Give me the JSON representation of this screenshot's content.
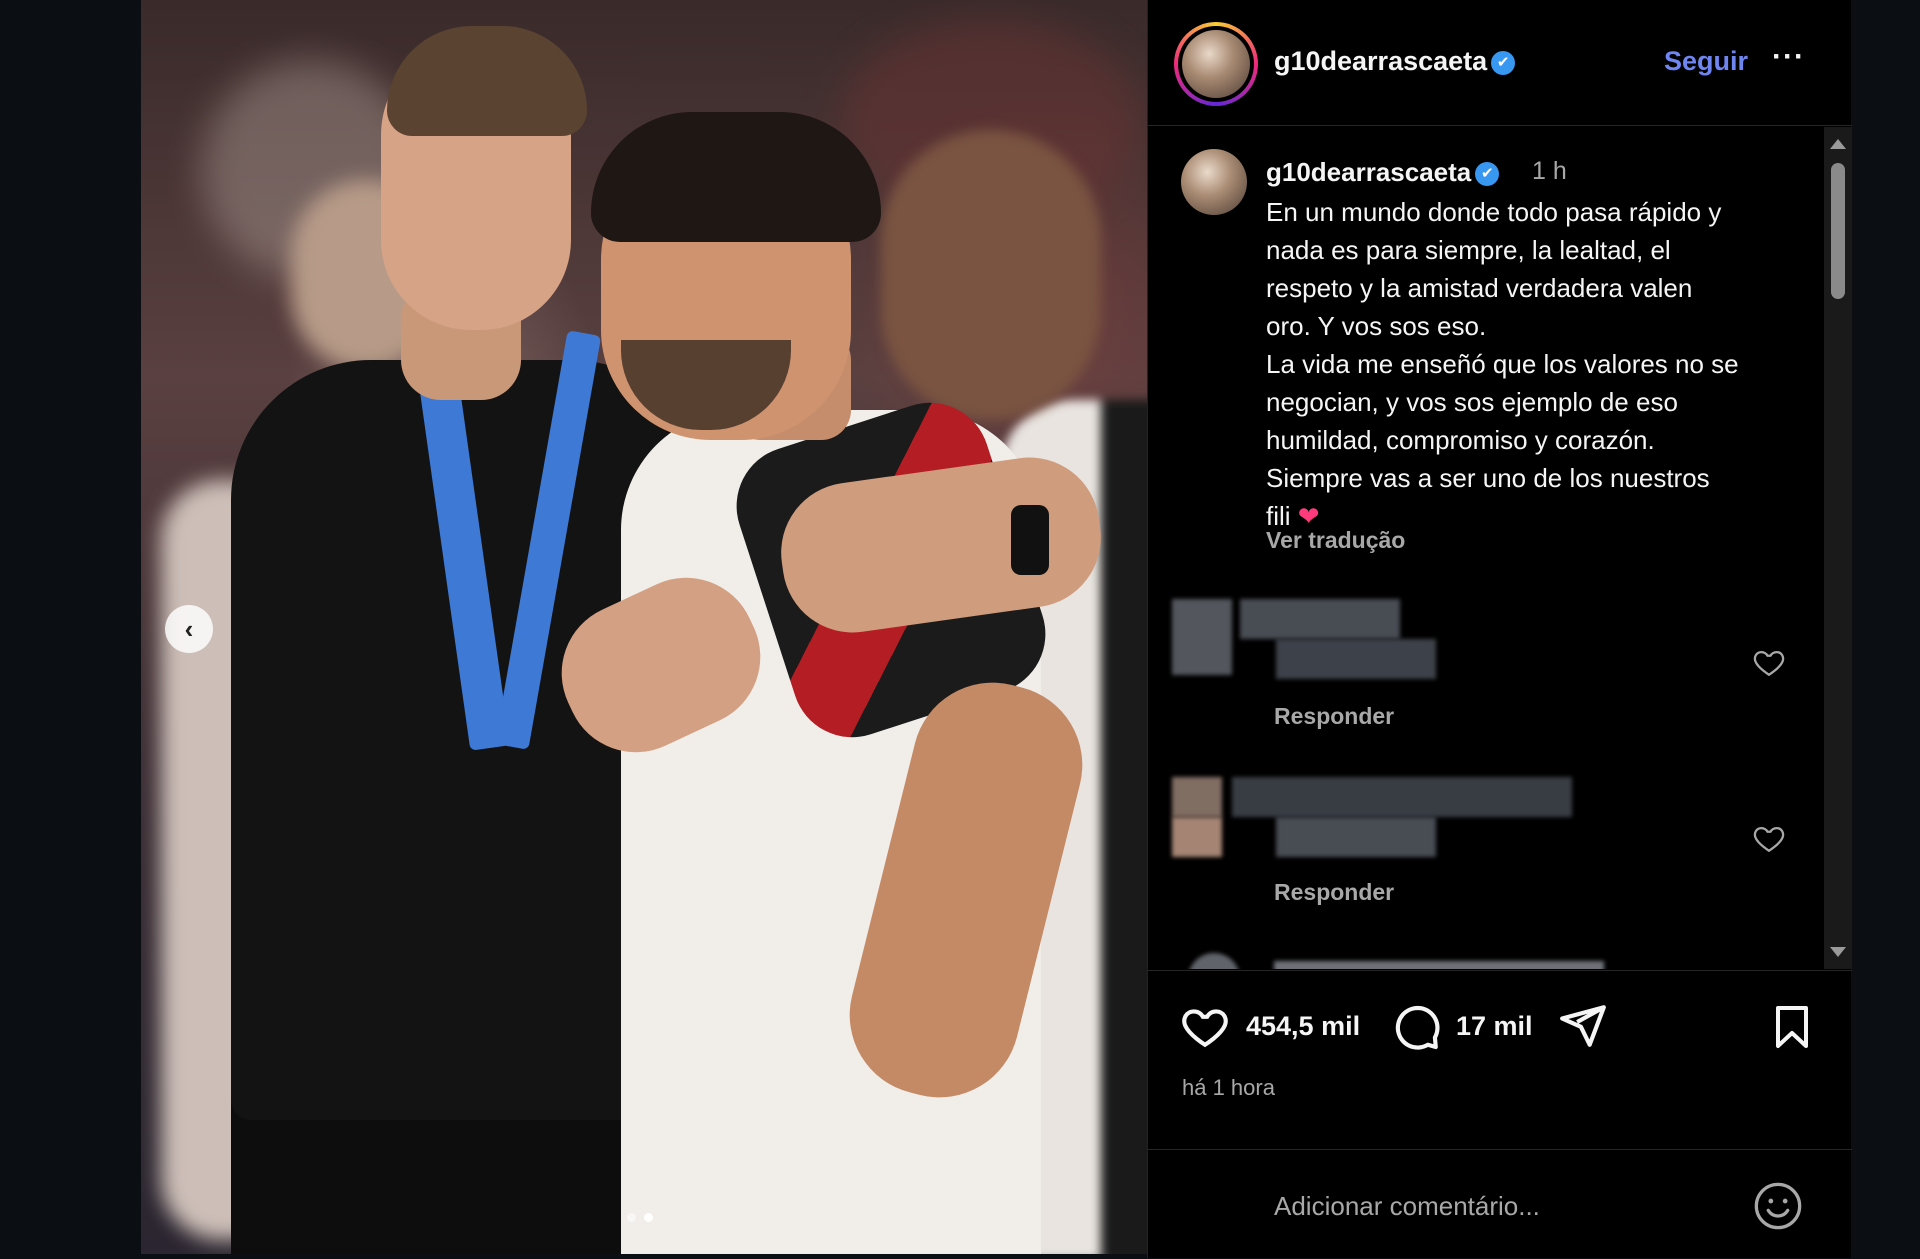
{
  "post": {
    "username": "g10dearrascaeta",
    "follow_label": "Seguir",
    "more_label": "···",
    "verified_mark": "✔"
  },
  "caption": {
    "username": "g10dearrascaeta",
    "time": "1 h",
    "text": "En un mundo donde todo pasa rápido y\nnada es para siempre, la lealtad, el\nrespeto y la amistad verdadera valen\noro. Y vos sos eso.\nLa vida me enseñó que los valores no se\nnegocian, y vos sos ejemplo de eso\nhumildad, compromiso y corazón.\nSiempre vas a ser uno de los nuestros\nfili",
    "emoji": "❤",
    "translate_label": "Ver tradução"
  },
  "comments": [
    {
      "reply_label": "Responder"
    },
    {
      "reply_label": "Responder"
    }
  ],
  "actions": {
    "likes": "454,5 mil",
    "comments": "17 mil",
    "posted": "há 1 hora"
  },
  "composer": {
    "placeholder": "Adicionar comentário..."
  },
  "carousel": {
    "prev_label": "‹",
    "slide_count": 2,
    "active_index": 1
  },
  "colors": {
    "follow": "#6f85f2",
    "verified": "#3897f0",
    "panel_bg": "#000000",
    "page_bg": "#0b0e13"
  },
  "icons": [
    "chevron-left-icon",
    "verified-icon",
    "more-icon",
    "heart-icon",
    "comment-icon",
    "share-icon",
    "bookmark-icon",
    "emoji-icon"
  ]
}
